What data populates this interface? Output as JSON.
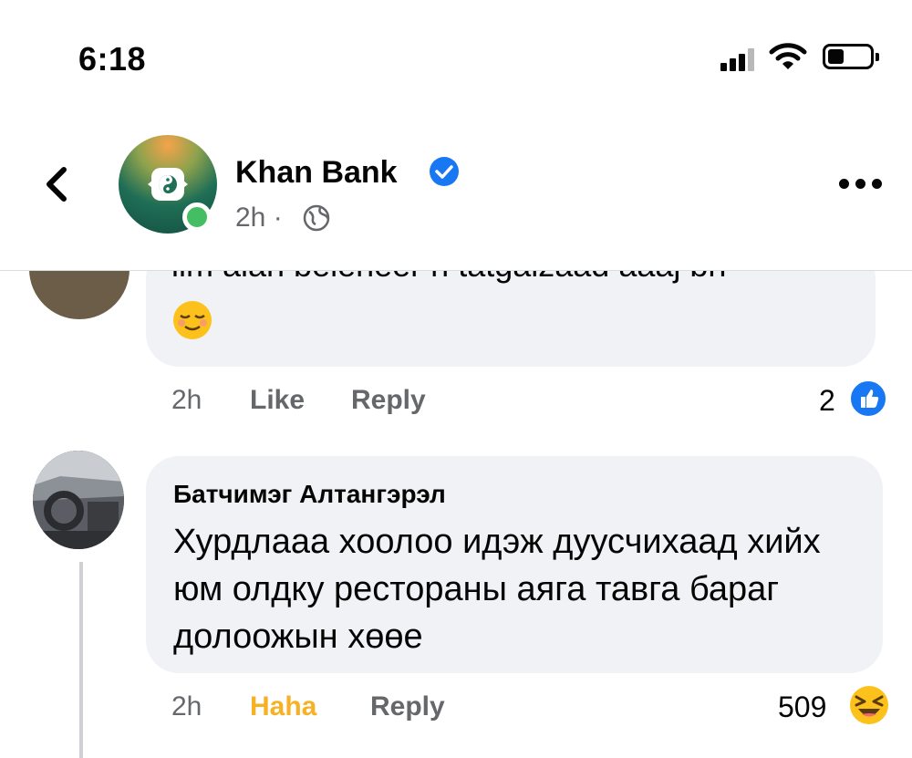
{
  "status_bar": {
    "time": "6:18"
  },
  "header": {
    "page_name": "Khan Bank",
    "post_time": "2h ·",
    "icons": [
      "back-chevron-icon",
      "bank-logo",
      "verified-badge-icon",
      "globe-icon",
      "more-options-icon"
    ]
  },
  "previous_comment": {
    "text_clipped": "ilm alan beleheer n tatgalzaad aaaj bn",
    "emoji": "😌",
    "time": "2h",
    "like_label": "Like",
    "reply_label": "Reply",
    "reaction_count": "2",
    "reaction": "like-icon"
  },
  "comment": {
    "author": "Батчимэг Алтангэрэл",
    "text": "Хурдлааа хоолоо идэж дуусчихаад хийх юм олдку ресторaны аяга тавга бараг долоожын хөөе",
    "time": "2h",
    "reaction_label": "Haha",
    "reply_label": "Reply",
    "reaction_count": "509",
    "reaction": "haha-emoji"
  },
  "colors": {
    "bubble": "#f0f2f5",
    "secondary_text": "#65676b",
    "haha": "#f7b125",
    "like_blue": "#1877f2",
    "online": "#45bd62"
  }
}
